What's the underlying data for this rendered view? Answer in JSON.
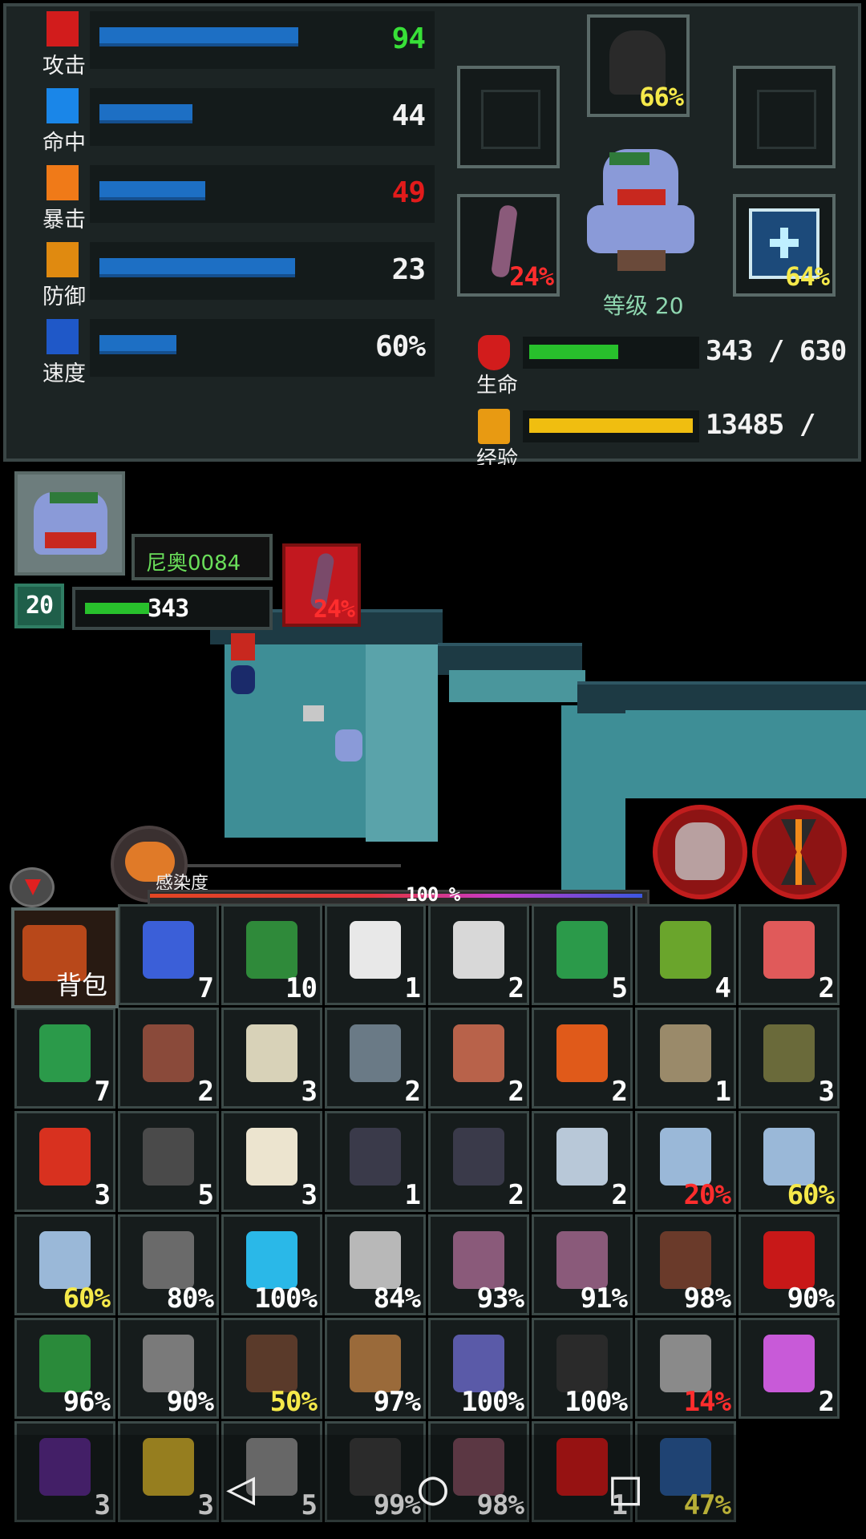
{
  "stats": [
    {
      "label": "攻击",
      "value": "94",
      "fill": 0.62,
      "value_color": "#38e038",
      "icon_color": "#d21c1c"
    },
    {
      "label": "命中",
      "value": "44",
      "fill": 0.29,
      "value_color": "#f2f2f2",
      "icon_color": "#1a86e8"
    },
    {
      "label": "暴击",
      "value": "49",
      "fill": 0.33,
      "value_color": "#e21b1b",
      "icon_color": "#f07a18"
    },
    {
      "label": "防御",
      "value": "23",
      "fill": 0.61,
      "value_color": "#f2f2f2",
      "icon_color": "#e08a10"
    },
    {
      "label": "速度",
      "value": "60%",
      "fill": 0.24,
      "value_color": "#f2f2f2",
      "icon_color": "#1f58c8"
    }
  ],
  "equipment": {
    "helmet_pct": "66%",
    "weapon_pct": "24%",
    "accessory_pct": "64%"
  },
  "level_text": "等级 20",
  "hp": {
    "label": "生命",
    "value": "343 / 630",
    "fill": 0.544
  },
  "exp": {
    "label": "经验",
    "value": "13485 /",
    "fill": 1.0
  },
  "hud": {
    "name": "尼奥0084",
    "level": "20",
    "hp": "343",
    "infect_slot_pct": "24%"
  },
  "infection": {
    "label": "感染度",
    "pct_text": "100 %",
    "fill": 1.0
  },
  "bag_label": "背包",
  "inventory": [
    {
      "name": "syringe",
      "count": "7",
      "color": "#3b5fd8"
    },
    {
      "name": "beer-bottle",
      "count": "10",
      "color": "#2f8a3a"
    },
    {
      "name": "bandage",
      "count": "1",
      "color": "#e8e8e8"
    },
    {
      "name": "medkit",
      "count": "2",
      "color": "#d8d8d8"
    },
    {
      "name": "green-bottle",
      "count": "5",
      "color": "#2b9a4a"
    },
    {
      "name": "apple",
      "count": "4",
      "color": "#6aa52c"
    },
    {
      "name": "brain",
      "count": "2",
      "color": "#e05a5a"
    },
    {
      "name": "green-bottle",
      "count": "7",
      "color": "#2b9a4a"
    },
    {
      "name": "jaw-trap",
      "count": "2",
      "color": "#8a4a3a"
    },
    {
      "name": "skull",
      "count": "3",
      "color": "#d8d2b8"
    },
    {
      "name": "stone",
      "count": "2",
      "color": "#6a7a86"
    },
    {
      "name": "flower-pot",
      "count": "2",
      "color": "#b8624a"
    },
    {
      "name": "molotov",
      "count": "2",
      "color": "#e05a1a"
    },
    {
      "name": "landmine",
      "count": "1",
      "color": "#9a8a6a"
    },
    {
      "name": "grenade",
      "count": "3",
      "color": "#6a6a3a"
    },
    {
      "name": "firecracker",
      "count": "3",
      "color": "#d8311f"
    },
    {
      "name": "dumbbell",
      "count": "5",
      "color": "#4a4a4a"
    },
    {
      "name": "bone",
      "count": "3",
      "color": "#ece4cf"
    },
    {
      "name": "bomb",
      "count": "1",
      "color": "#3a3a4a"
    },
    {
      "name": "bomb",
      "count": "2",
      "color": "#3a3a4a"
    },
    {
      "name": "flask",
      "count": "2",
      "color": "#b8c8d8"
    },
    {
      "name": "light-tube",
      "count": "20%",
      "count_style": "red",
      "color": "#9ab8d8"
    },
    {
      "name": "light-tube",
      "count": "60%",
      "count_style": "yellow",
      "color": "#9ab8d8"
    },
    {
      "name": "light-tube",
      "count": "60%",
      "count_style": "yellow",
      "color": "#9ab8d8"
    },
    {
      "name": "shovel",
      "count": "80%",
      "color": "#6a6a6a"
    },
    {
      "name": "energy-shield",
      "count": "100%",
      "color": "#2ab8e8"
    },
    {
      "name": "machete",
      "count": "84%",
      "color": "#b8b8b8"
    },
    {
      "name": "tentacle-whip",
      "count": "93%",
      "color": "#8a5a7a"
    },
    {
      "name": "tentacle-whip",
      "count": "91%",
      "color": "#8a5a7a"
    },
    {
      "name": "cane",
      "count": "98%",
      "color": "#6a3a2a"
    },
    {
      "name": "red-gauntlet",
      "count": "90%",
      "color": "#c81818"
    },
    {
      "name": "green-cloak",
      "count": "96%",
      "color": "#2a8a3a"
    },
    {
      "name": "assault-rifle",
      "count": "90%",
      "color": "#7a7a7a"
    },
    {
      "name": "minigun",
      "count": "50%",
      "count_style": "yellow",
      "color": "#5a3a2a"
    },
    {
      "name": "crossbow",
      "count": "97%",
      "color": "#9a6a3a"
    },
    {
      "name": "scope-gun",
      "count": "100%",
      "color": "#5a5aa8"
    },
    {
      "name": "dark-helmet",
      "count": "100%",
      "color": "#2a2a2a"
    },
    {
      "name": "zombie-mask",
      "count": "14%",
      "count_style": "red",
      "color": "#8a8a8a"
    },
    {
      "name": "potion",
      "count": "2",
      "color": "#c85ad8"
    },
    {
      "name": "purple-vial",
      "count": "3",
      "color": "#5a2a8a"
    },
    {
      "name": "key",
      "count": "3",
      "color": "#c8a82a"
    },
    {
      "name": "keycard",
      "count": "5",
      "color": "#8a8a8a"
    },
    {
      "name": "armor",
      "count": "99%",
      "color": "#3a3a3a"
    },
    {
      "name": "zombie-hand",
      "count": "98%",
      "color": "#7a4a5a"
    },
    {
      "name": "dynamite",
      "count": "1",
      "color": "#c81818"
    },
    {
      "name": "upgrade-box",
      "count": "47%",
      "count_style": "yellow",
      "color": "#2a5a9a"
    }
  ],
  "nav": {
    "back": "◁",
    "home": "○",
    "recent": "□"
  }
}
